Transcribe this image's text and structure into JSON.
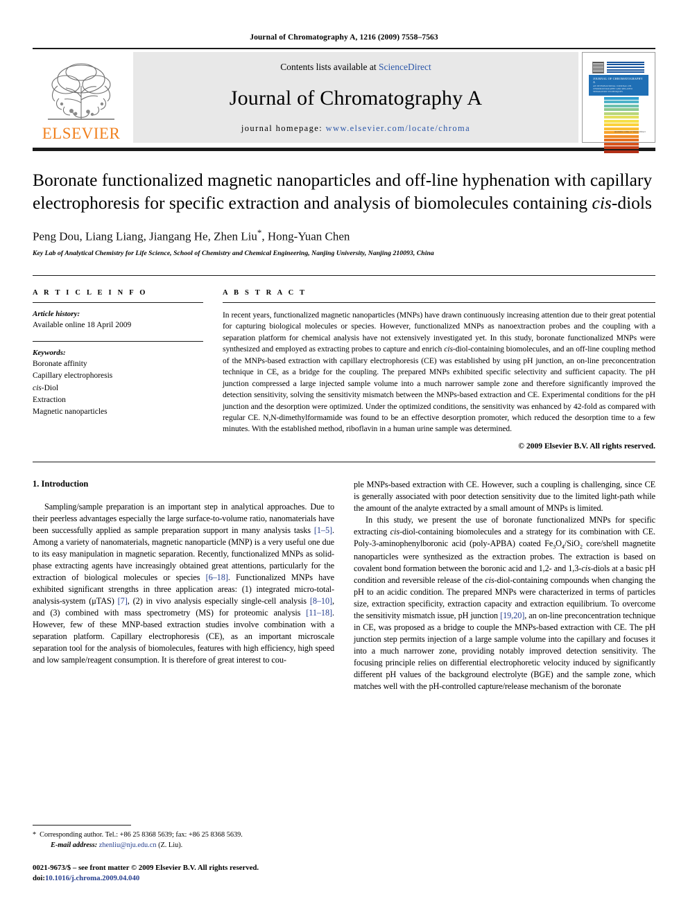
{
  "running_head": "Journal of Chromatography A, 1216 (2009) 7558–7563",
  "masthead": {
    "publisher": "ELSEVIER",
    "contents_prefix": "Contents lists available at ",
    "contents_link": "ScienceDirect",
    "journal_name": "Journal of Chromatography A",
    "homepage_label": "journal homepage: ",
    "homepage_url": "www.elsevier.com/locate/chroma",
    "cover_title": "JOURNAL OF CHROMATOGRAPHY A",
    "cover_subtitle": "AN INTERNATIONAL JOURNAL ON CHROMATOGRAPHY AND RELATED SEPARATION TECHNIQUES",
    "cover_footer": "Available online at\nScienceDirect",
    "accent_orange": "#f0801e",
    "link_blue": "#2b56a8",
    "cover_blue": "#1f6fb5"
  },
  "article": {
    "title": "Boronate functionalized magnetic nanoparticles and off-line hyphenation with capillary electrophoresis for specific extraction and analysis of biomolecules containing cis-diols",
    "title_part1": "Boronate functionalized magnetic nanoparticles and off-line hyphenation with capillary electrophoresis for specific extraction and analysis of biomolecules containing ",
    "title_italic": "cis",
    "title_part2": "-diols",
    "authors": "Peng Dou, Liang Liang, Jiangang He, Zhen Liu",
    "authors_tail": ", Hong-Yuan Chen",
    "corresponding_mark": "*",
    "affiliation": "Key Lab of Analytical Chemistry for Life Science, School of Chemistry and Chemical Engineering, Nanjing University, Nanjing 210093, China"
  },
  "info": {
    "heading": "A R T I C L E   I N F O",
    "history_label": "Article history:",
    "history_value": "Available online 18 April 2009",
    "keywords_label": "Keywords:",
    "keywords": [
      "Boronate affinity",
      "Capillary electrophoresis",
      "cis-Diol",
      "Extraction",
      "Magnetic nanoparticles"
    ]
  },
  "abstract": {
    "heading": "A B S T R A C T",
    "text": "In recent years, functionalized magnetic nanoparticles (MNPs) have drawn continuously increasing attention due to their great potential for capturing biological molecules or species. However, functionalized MNPs as nanoextraction probes and the coupling with a separation platform for chemical analysis have not extensively investigated yet. In this study, boronate functionalized MNPs were synthesized and employed as extracting probes to capture and enrich cis-diol-containing biomolecules, and an off-line coupling method of the MNPs-based extraction with capillary electrophoresis (CE) was established by using pH junction, an on-line preconcentration technique in CE, as a bridge for the coupling. The prepared MNPs exhibited specific selectivity and sufficient capacity. The pH junction compressed a large injected sample volume into a much narrower sample zone and therefore significantly improved the detection sensitivity, solving the sensitivity mismatch between the MNPs-based extraction and CE. Experimental conditions for the pH junction and the desorption were optimized. Under the optimized conditions, the sensitivity was enhanced by 42-fold as compared with regular CE. N,N-dimethylformamide was found to be an effective desorption promoter, which reduced the desorption time to a few minutes. With the established method, riboflavin in a human urine sample was determined.",
    "copyright": "© 2009 Elsevier B.V. All rights reserved."
  },
  "intro": {
    "heading": "1.  Introduction",
    "para1": "Sampling/sample preparation is an important step in analytical approaches. Due to their peerless advantages especially the large surface-to-volume ratio, nanomaterials have been successfully applied as sample preparation support in many analysis tasks [1–5]. Among a variety of nanomaterials, magnetic nanoparticle (MNP) is a very useful one due to its easy manipulation in magnetic separation. Recently, functionalized MNPs as solid-phase extracting agents have increasingly obtained great attentions, particularly for the extraction of biological molecules or species [6–18]. Functionalized MNPs have exhibited significant strengths in three application areas: (1) integrated micro-total-analysis-system (μTAS) [7], (2) in vivo analysis especially single-cell analysis [8–10], and (3) combined with mass spectrometry (MS) for proteomic analysis [11–18]. However, few of these MNP-based extraction studies involve combination with a separation platform. Capillary electrophoresis (CE), as an important microscale separation tool for the analysis of biomolecules, features with high efficiency, high speed and low sample/reagent consumption. It is therefore of great interest to couple MNPs-based extraction with CE. However, such a coupling is challenging, since CE is generally associated with poor detection sensitivity due to the limited light-path while the amount of the analyte extracted by a small amount of MNPs is limited.",
    "para2": "In this study, we present the use of boronate functionalized MNPs for specific extracting cis-diol-containing biomolecules and a strategy for its combination with CE. Poly-3-aminophenylboronic acid (poly-APBA) coated Fe3O4/SiO2 core/shell magnetite nanoparticles were synthesized as the extraction probes. The extraction is based on covalent bond formation between the boronic acid and 1,2- and 1,3-cis-diols at a basic pH condition and reversible release of the cis-diol-containing compounds when changing the pH to an acidic condition. The prepared MNPs were characterized in terms of particles size, extraction specificity, extraction capacity and extraction equilibrium. To overcome the sensitivity mismatch issue, pH junction [19,20], an on-line preconcentration technique in CE, was proposed as a bridge to couple the MNPs-based extraction with CE. The pH junction step permits injection of a large sample volume into the capillary and focuses it into a much narrower zone, providing notably improved detection sensitivity. The focusing principle relies on differential electrophoretic velocity induced by significantly different pH values of the background electrolyte (BGE) and the sample zone, which matches well with the pH-controlled capture/release mechanism of the boronate"
  },
  "footnotes": {
    "corresponding": "Corresponding author. Tel.: +86 25 8368 5639; fax: +86 25 8368 5639.",
    "email_label": "E-mail address:",
    "email": "zhenliu@nju.edu.cn",
    "email_suffix": "(Z. Liu).",
    "issn_line": "0021-9673/$ – see front matter © 2009 Elsevier B.V. All rights reserved.",
    "doi_label": "doi:",
    "doi_value": "10.1016/j.chroma.2009.04.040"
  }
}
